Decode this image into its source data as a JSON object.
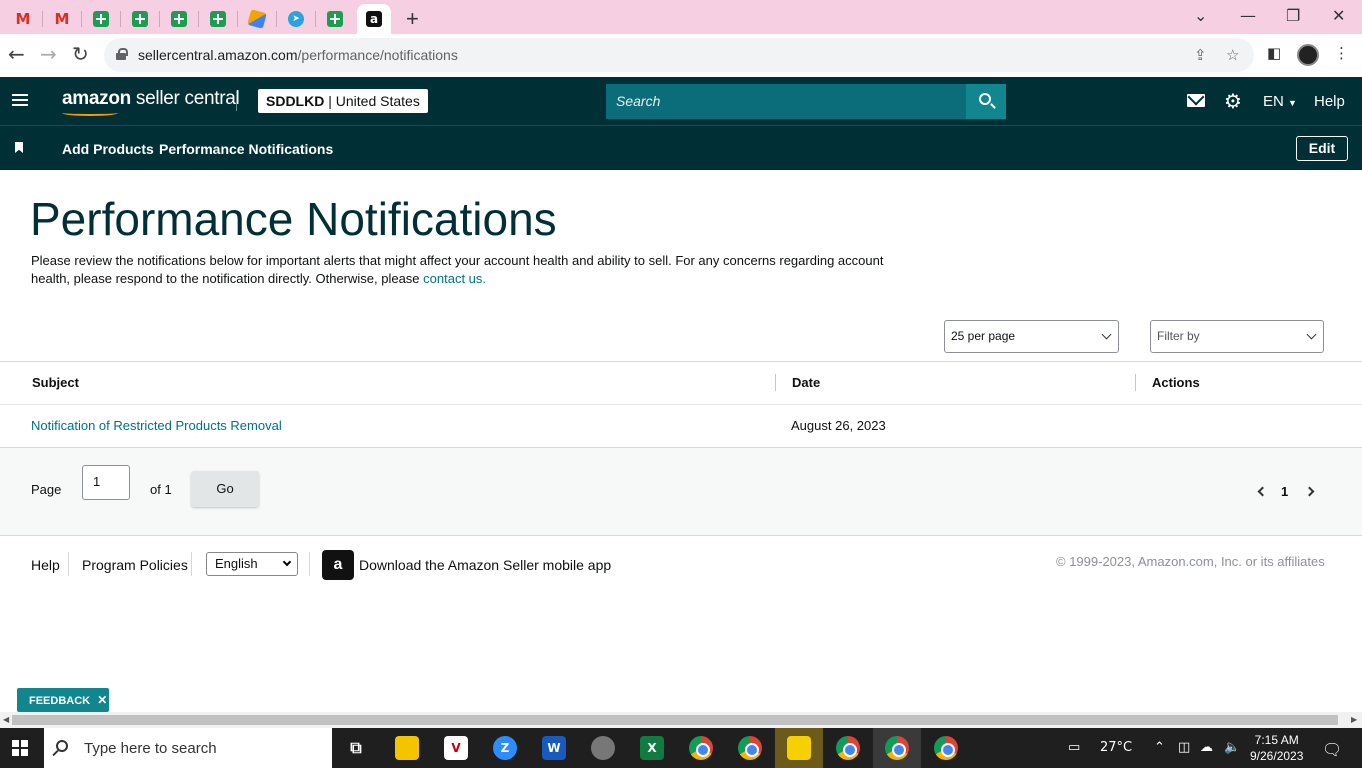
{
  "browser": {
    "url_domain": "sellercentral.amazon.com",
    "url_path": "/performance/notifications",
    "tabs": [
      {
        "icon": "gmail-icon",
        "glyph": "M"
      },
      {
        "icon": "gmail-icon",
        "glyph": "M"
      },
      {
        "icon": "sheets-icon",
        "glyph": ""
      },
      {
        "icon": "sheets-icon",
        "glyph": ""
      },
      {
        "icon": "sheets-icon",
        "glyph": ""
      },
      {
        "icon": "sheets-icon",
        "glyph": ""
      },
      {
        "icon": "pen-app-icon",
        "glyph": ""
      },
      {
        "icon": "telegram-icon",
        "glyph": "➤"
      },
      {
        "icon": "sheets-icon",
        "glyph": ""
      },
      {
        "icon": "amazon-icon",
        "glyph": "a"
      }
    ]
  },
  "header": {
    "brand_bold": "amazon",
    "brand_rest": " seller central",
    "account_name": "SDDLKD",
    "account_region": "United States",
    "search_placeholder": "Search",
    "language": "EN",
    "help": "Help"
  },
  "subnav": {
    "items": [
      "Add Products",
      "Performance Notifications"
    ],
    "edit": "Edit"
  },
  "main": {
    "title": "Performance Notifications",
    "description": "Please review the notifications below for important alerts that might affect your account health and ability to sell. For any concerns regarding account health, please respond to the notification directly. Otherwise, please ",
    "contact_link": "contact us.",
    "per_page": "25 per page",
    "filter": "Filter by"
  },
  "table": {
    "columns": [
      "Subject",
      "Date",
      "Actions"
    ],
    "rows": [
      {
        "subject": "Notification of Restricted Products Removal",
        "date": "August 26, 2023",
        "actions": ""
      }
    ]
  },
  "pagination": {
    "page_label": "Page",
    "page_value": "1",
    "of_label": "of 1",
    "go": "Go",
    "current": "1"
  },
  "footer": {
    "help": "Help",
    "policies": "Program Policies",
    "language": "English",
    "app_text": "Download the Amazon Seller mobile app",
    "copyright": "© 1999-2023, Amazon.com, Inc. or its affiliates"
  },
  "feedback": "FEEDBACK",
  "taskbar": {
    "search_placeholder": "Type here to search",
    "temperature": "27°C",
    "time": "7:15 AM",
    "date": "9/26/2023"
  }
}
